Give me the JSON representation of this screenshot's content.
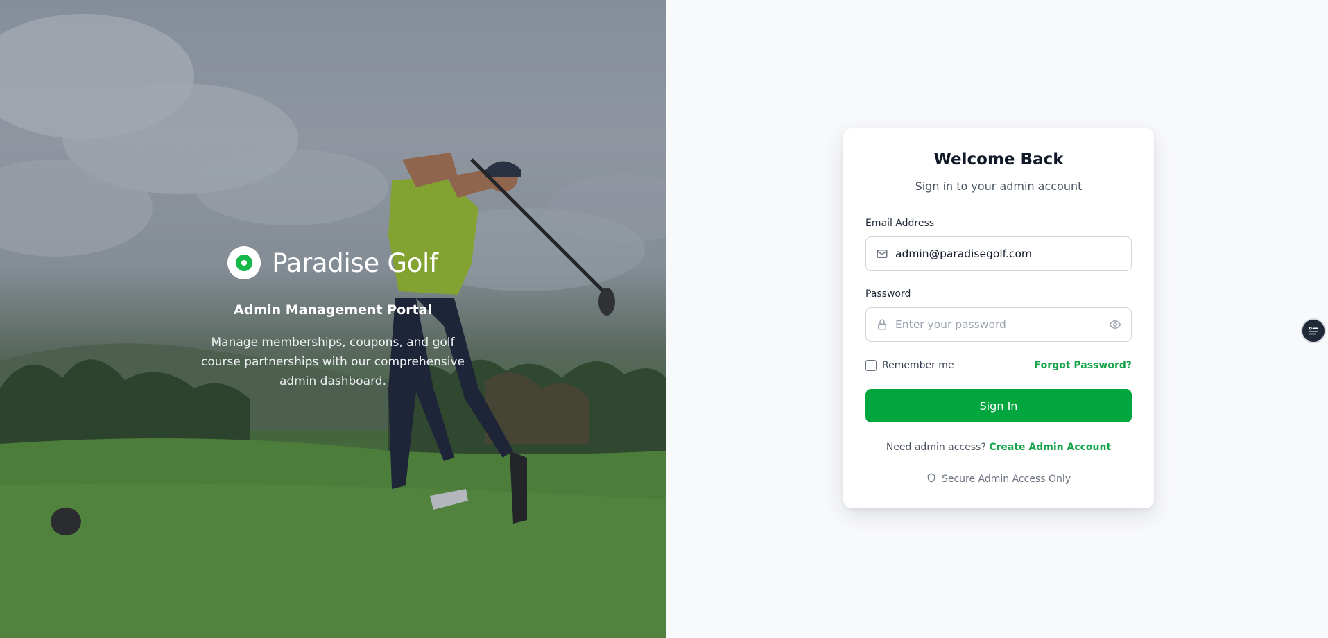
{
  "hero": {
    "brand_name": "Paradise Golf",
    "subtitle": "Admin Management Portal",
    "description": "Manage memberships, coupons, and golf course partnerships with our comprehensive admin dashboard.",
    "brand_color": "#16b84a"
  },
  "login": {
    "title": "Welcome Back",
    "subtitle": "Sign in to your admin account",
    "email_label": "Email Address",
    "email_value": "admin@paradisegolf.com",
    "password_label": "Password",
    "password_placeholder": "Enter your password",
    "remember_label": "Remember me",
    "remember_checked": false,
    "forgot_label": "Forgot Password?",
    "signin_label": "Sign In",
    "need_access_text": "Need admin access?",
    "create_account_label": "Create Admin Account",
    "secure_text": "Secure Admin Access Only",
    "accent_color": "#01a63f"
  },
  "icons": {
    "email": "mail-icon",
    "password": "lock-icon",
    "toggle_password": "eye-icon",
    "secure": "shield-icon",
    "edge_widget": "menu-list-icon"
  }
}
